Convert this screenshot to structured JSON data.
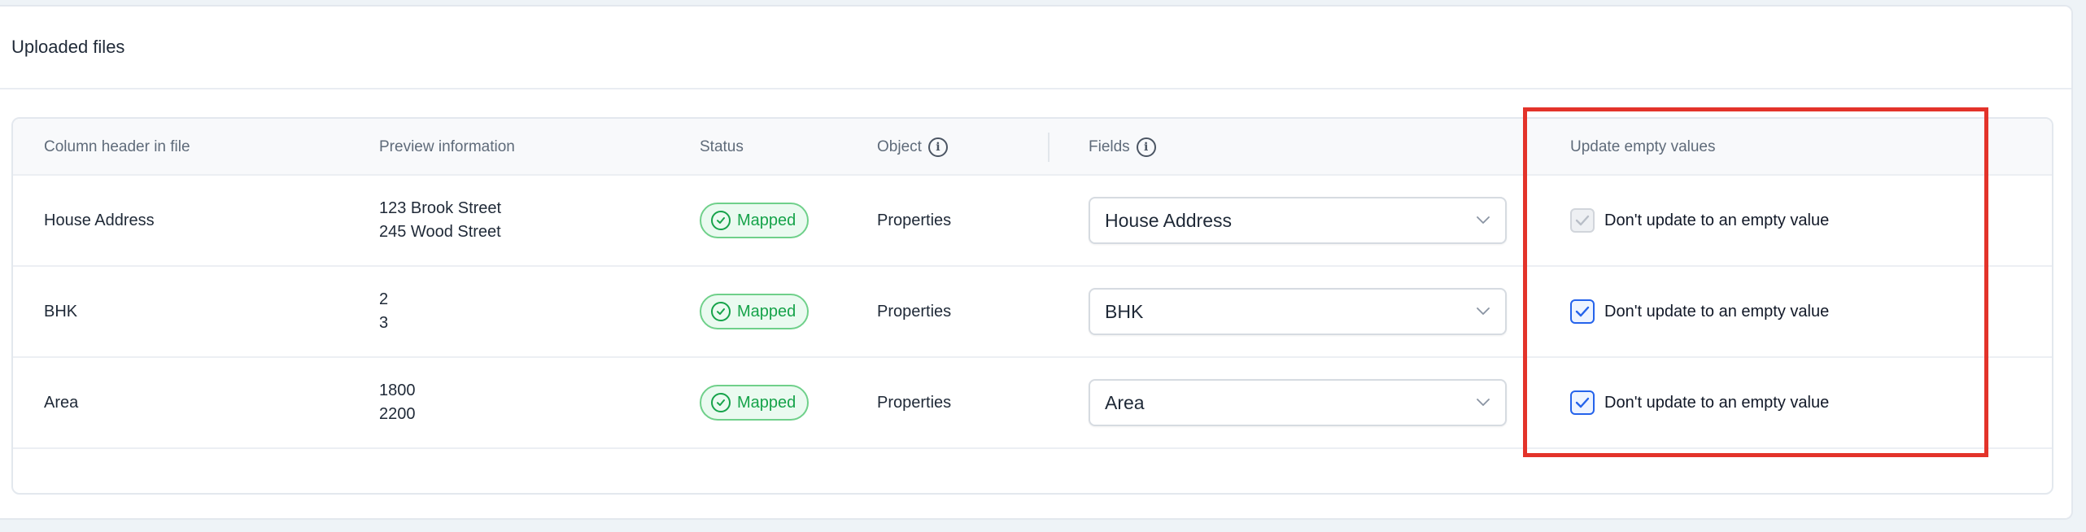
{
  "section": {
    "title": "Uploaded files"
  },
  "table": {
    "headers": {
      "column": "Column header in file",
      "preview": "Preview information",
      "status": "Status",
      "object": "Object",
      "fields": "Fields",
      "update": "Update empty values"
    },
    "rows": [
      {
        "column": "House Address",
        "preview": [
          "123 Brook Street",
          "245 Wood Street"
        ],
        "status": "Mapped",
        "object": "Properties",
        "field": "House Address",
        "checkbox_label": "Don't update to an empty value",
        "checked": true,
        "disabled": true
      },
      {
        "column": "BHK",
        "preview": [
          "2",
          "3"
        ],
        "status": "Mapped",
        "object": "Properties",
        "field": "BHK",
        "checkbox_label": "Don't update to an empty value",
        "checked": true,
        "disabled": false
      },
      {
        "column": "Area",
        "preview": [
          "1800",
          "2200"
        ],
        "status": "Mapped",
        "object": "Properties",
        "field": "Area",
        "checkbox_label": "Don't update to an empty value",
        "checked": true,
        "disabled": false
      }
    ]
  },
  "colors": {
    "accent": "#2563eb",
    "success": "#16a34a",
    "highlight": "#e3332a"
  },
  "icons": {
    "info": "info-icon",
    "status": "check-circle-icon",
    "select": "chevron-down-icon",
    "checkbox": "checkmark-icon"
  }
}
